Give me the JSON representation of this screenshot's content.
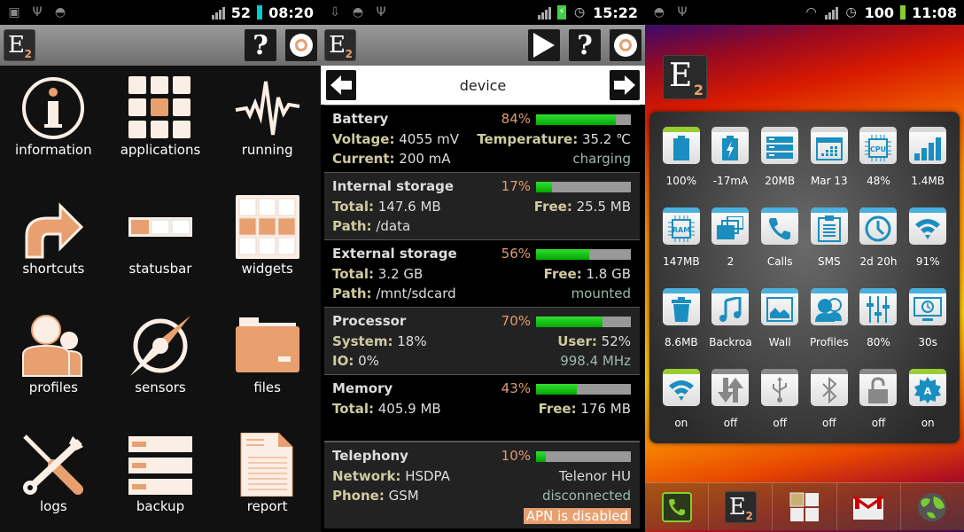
{
  "colors": {
    "accent": "#e8a070",
    "widget_blue": "#1a8ec0",
    "bar_green": "#00aa00",
    "on_green": "#9acd32"
  },
  "screen1": {
    "status": {
      "battery": "52",
      "time": "08:20"
    },
    "appbar": {
      "logo": "E",
      "logo_sub": "2",
      "help_label": "?"
    },
    "tiles": [
      {
        "label": "information",
        "icon": "info-icon"
      },
      {
        "label": "applications",
        "icon": "apps-grid-icon"
      },
      {
        "label": "running",
        "icon": "pulse-icon"
      },
      {
        "label": "shortcuts",
        "icon": "shortcut-arrow-icon"
      },
      {
        "label": "statusbar",
        "icon": "statusbar-icon"
      },
      {
        "label": "widgets",
        "icon": "widgets-grid-icon"
      },
      {
        "label": "profiles",
        "icon": "profiles-icon"
      },
      {
        "label": "sensors",
        "icon": "compass-icon"
      },
      {
        "label": "files",
        "icon": "folder-icon"
      },
      {
        "label": "logs",
        "icon": "tools-icon"
      },
      {
        "label": "backup",
        "icon": "backup-icon"
      },
      {
        "label": "report",
        "icon": "document-icon"
      }
    ]
  },
  "screen2": {
    "status": {
      "time": "15:22"
    },
    "appbar": {
      "logo": "E",
      "logo_sub": "2",
      "help_label": "?"
    },
    "nav": {
      "title": "device"
    },
    "sections": [
      {
        "title": "Battery",
        "percent": 84,
        "percent_label": "84%",
        "rows": [
          {
            "lk": "Voltage:",
            "lv": " 4055 mV",
            "rk": "Temperature:",
            "rv": " 35.2 ℃"
          },
          {
            "lk": "Current:",
            "lv": " 200 mA",
            "rk": "",
            "rv": "",
            "status": "charging"
          }
        ]
      },
      {
        "title": "Internal storage",
        "percent": 17,
        "percent_label": "17%",
        "rows": [
          {
            "lk": "Total:",
            "lv": " 147.6 MB",
            "rk": "Free:",
            "rv": " 25.5 MB"
          },
          {
            "lk": "Path:",
            "lv": " /data",
            "rk": "",
            "rv": ""
          }
        ]
      },
      {
        "title": "External storage",
        "percent": 56,
        "percent_label": "56%",
        "rows": [
          {
            "lk": "Total:",
            "lv": " 3.2 GB",
            "rk": "Free:",
            "rv": " 1.8 GB"
          },
          {
            "lk": "Path:",
            "lv": " /mnt/sdcard",
            "rk": "",
            "rv": "",
            "status": "mounted"
          }
        ]
      },
      {
        "title": "Processor",
        "percent": 70,
        "percent_label": "70%",
        "rows": [
          {
            "lk": "System:",
            "lv": " 18%",
            "rk": "User:",
            "rv": " 52%"
          },
          {
            "lk": "IO:",
            "lv": " 0%",
            "rk": "",
            "rv": "",
            "status": "998.4 MHz"
          }
        ]
      },
      {
        "title": "Memory",
        "percent": 43,
        "percent_label": "43%",
        "rows": [
          {
            "lk": "Total:",
            "lv": " 405.9 MB",
            "rk": "Free:",
            "rv": " 176 MB"
          }
        ]
      },
      {
        "title": "Telephony",
        "percent": 10,
        "percent_label": "10%",
        "rows": [
          {
            "lk": "Network:",
            "lv": " HSDPA",
            "rk": "",
            "rv": "Telenor HU"
          },
          {
            "lk": "Phone:",
            "lv": " GSM",
            "rk": "",
            "rv": "",
            "status": "disconnected"
          }
        ],
        "badge": "APN is disabled"
      }
    ]
  },
  "screen3": {
    "status": {
      "battery": "100",
      "time": "11:08"
    },
    "desktop_icon": {
      "logo": "E",
      "logo_sub": "2"
    },
    "widgets": [
      {
        "label": "100%",
        "icon": "battery-icon",
        "state": "on"
      },
      {
        "label": "-17mA",
        "icon": "battery-charge-icon",
        "state": "neutral"
      },
      {
        "label": "20MB",
        "icon": "storage-icon",
        "state": "neutral"
      },
      {
        "label": "Mar 13",
        "icon": "calendar-icon",
        "state": "neutral"
      },
      {
        "label": "48%",
        "icon": "cpu-icon",
        "state": "neutral"
      },
      {
        "label": "1.4MB",
        "icon": "signal-icon",
        "state": "neutral"
      },
      {
        "label": "147MB",
        "icon": "ram-icon",
        "state": "blue"
      },
      {
        "label": "2",
        "icon": "windows-icon",
        "state": "blue"
      },
      {
        "label": "Calls",
        "icon": "phone-icon",
        "state": "blue"
      },
      {
        "label": "SMS",
        "icon": "clipboard-icon",
        "state": "blue"
      },
      {
        "label": "2d 20h",
        "icon": "clock-icon",
        "state": "blue"
      },
      {
        "label": "91%",
        "icon": "wifi-icon",
        "state": "blue"
      },
      {
        "label": "8.6MB",
        "icon": "trash-icon",
        "state": "blue"
      },
      {
        "label": "Backroa",
        "icon": "music-icon",
        "state": "blue"
      },
      {
        "label": "Wall",
        "icon": "image-icon",
        "state": "blue"
      },
      {
        "label": "Profiles",
        "icon": "profiles-icon",
        "state": "blue"
      },
      {
        "label": "80%",
        "icon": "sliders-icon",
        "state": "blue"
      },
      {
        "label": "30s",
        "icon": "monitor-timer-icon",
        "state": "blue"
      },
      {
        "label": "on",
        "icon": "wifi-toggle-icon",
        "state": "on"
      },
      {
        "label": "off",
        "icon": "data-sync-icon",
        "state": "off"
      },
      {
        "label": "off",
        "icon": "usb-icon",
        "state": "off"
      },
      {
        "label": "off",
        "icon": "bluetooth-icon",
        "state": "off"
      },
      {
        "label": "off",
        "icon": "lock-icon",
        "state": "off"
      },
      {
        "label": "on",
        "icon": "auto-rotate-icon",
        "state": "on"
      }
    ],
    "dock": [
      {
        "name": "phone-icon"
      },
      {
        "name": "e2-app-icon"
      },
      {
        "name": "app-drawer-icon"
      },
      {
        "name": "gmail-icon"
      },
      {
        "name": "browser-globe-icon"
      }
    ]
  }
}
